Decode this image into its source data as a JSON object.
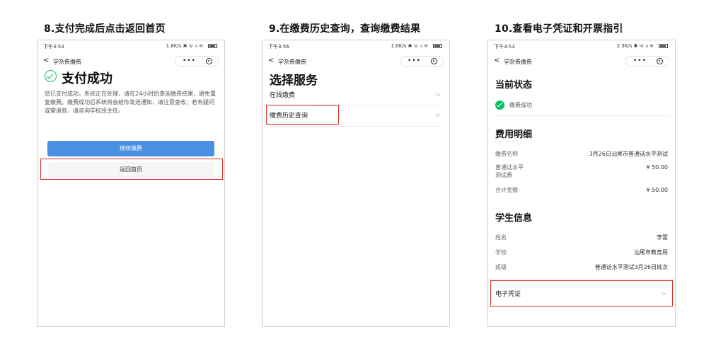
{
  "panels": [
    {
      "heading": "8.支付完成后点击返回首页",
      "status": {
        "time": "下午3:53",
        "net": "1.8K/s ✱ ᯤ ᵢₗₗ ≋"
      },
      "nav": {
        "back": "<",
        "title": "学杂费缴费",
        "menu": "•••"
      },
      "success_title": "支付成功",
      "description": "您已支付成功，系统正在处理，请在24小时后查询缴费结果，避免重复缴费。缴费成功后系统将会给你发送通知，请注意查收；若有疑问或需退款，请咨询学校班主任。",
      "continue_button": "继续缴费",
      "home_button": "返回首页"
    },
    {
      "heading": "9.在缴费历史查询，查询缴费结果",
      "status": {
        "time": "下午3:56",
        "net": "1.0K/s ✱ ᯤ ᵢₗₗ ≋"
      },
      "nav": {
        "back": "<",
        "title": "学杂费缴费",
        "menu": "•••"
      },
      "service_title": "选择服务",
      "menu_items": [
        {
          "label": "在线缴费",
          "chevron": ">"
        },
        {
          "label": "缴费历史查询",
          "chevron": ">"
        }
      ]
    },
    {
      "heading": "10.查看电子凭证和开票指引",
      "status": {
        "time": "下午3:53",
        "net": "2.3K/s ✱ ᯤ ᵢₗₗ ≋"
      },
      "nav": {
        "back": "<",
        "title": "学杂费缴费",
        "menu": "•••"
      },
      "current_status_title": "当前状态",
      "status_text": "缴费成功",
      "fee_detail_title": "费用明细",
      "fee_rows": [
        {
          "k": "缴费名称",
          "v": "3月26日汕尾市普通话水平测试"
        },
        {
          "k": "普通话水平\n测试费",
          "v": "¥ 50.00"
        },
        {
          "k": "合计金额",
          "v": "¥ 50.00"
        }
      ],
      "student_title": "学生信息",
      "student_rows": [
        {
          "k": "姓名",
          "v": "李蕾"
        },
        {
          "k": "学校",
          "v": "汕尾市教育局"
        },
        {
          "k": "班级",
          "v": "普通话水平测试3月26日批次"
        }
      ],
      "voucher": {
        "label": "电子凭证",
        "chevron": ">"
      }
    }
  ],
  "colors": {
    "success": "#07c160",
    "primary": "#4a90e2",
    "highlight": "#d93026"
  }
}
